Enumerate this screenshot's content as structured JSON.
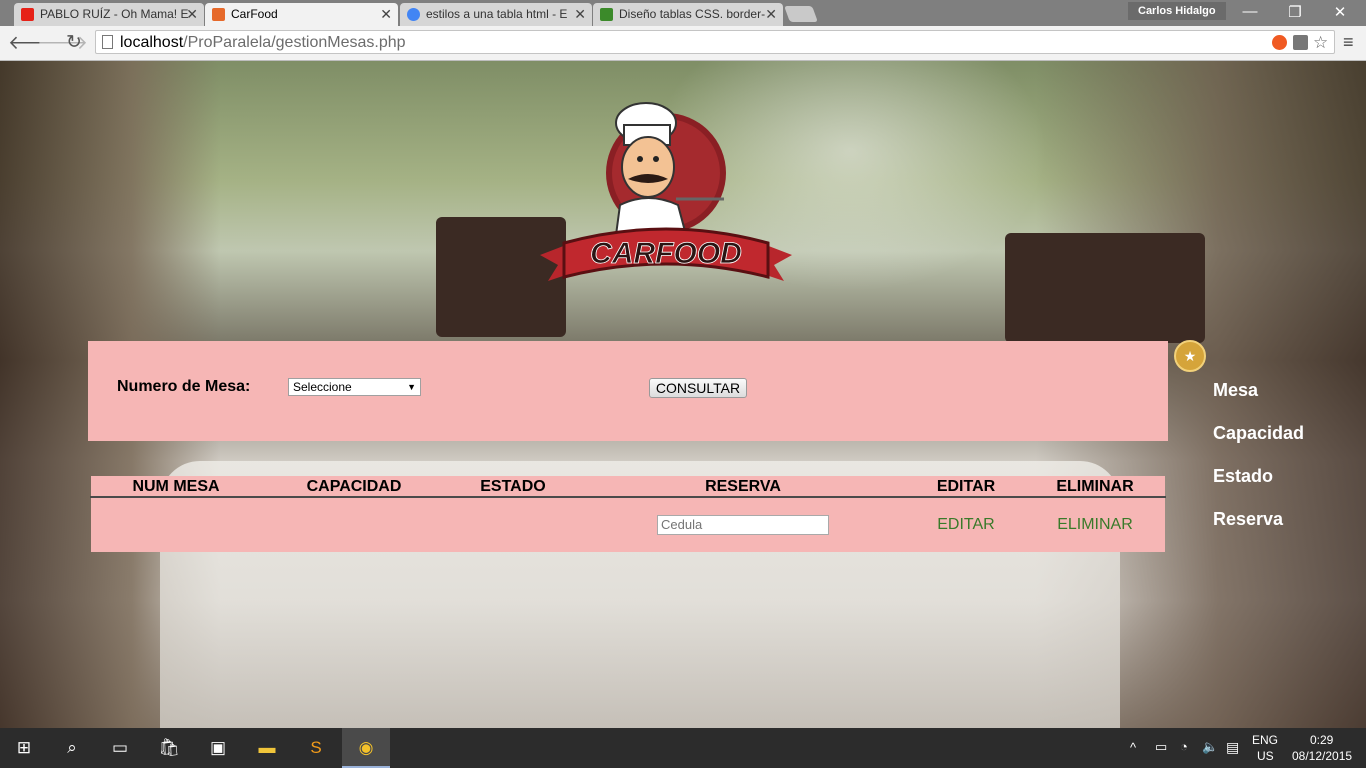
{
  "browser": {
    "tabs": [
      {
        "title": "PABLO RUÍZ - Oh Mama! E",
        "favicon_color": "#e62117"
      },
      {
        "title": "CarFood",
        "favicon_color": "#e6692a",
        "active": true
      },
      {
        "title": "estilos a una tabla html - E",
        "favicon_color": "#4285f4"
      },
      {
        "title": "Diseño tablas CSS. border-",
        "favicon_color": "#3b8a2a"
      }
    ],
    "user_name": "Carlos Hidalgo",
    "url_host": "localhost",
    "url_path": "/ProParalela/gestionMesas.php"
  },
  "logo": {
    "text": "CARFOOD"
  },
  "form": {
    "label": "Numero de Mesa:",
    "select_value": "Seleccione",
    "button_label": "CONSULTAR"
  },
  "table": {
    "headers": [
      "NUM MESA",
      "CAPACIDAD",
      "ESTADO",
      "RESERVA",
      "EDITAR",
      "ELIMINAR"
    ],
    "cedula_placeholder": "Cedula",
    "edit_link": "EDITAR",
    "delete_link": "ELIMINAR"
  },
  "side_menu": {
    "items": [
      "Mesa",
      "Capacidad",
      "Estado",
      "Reserva"
    ]
  },
  "taskbar": {
    "lang_line1": "ENG",
    "lang_line2": "US",
    "time": "0:29",
    "date": "08/12/2015"
  },
  "colors": {
    "panel_pink": "#f6b6b5",
    "link_green": "#3a7a2a",
    "badge_gold": "#d5a43a"
  }
}
